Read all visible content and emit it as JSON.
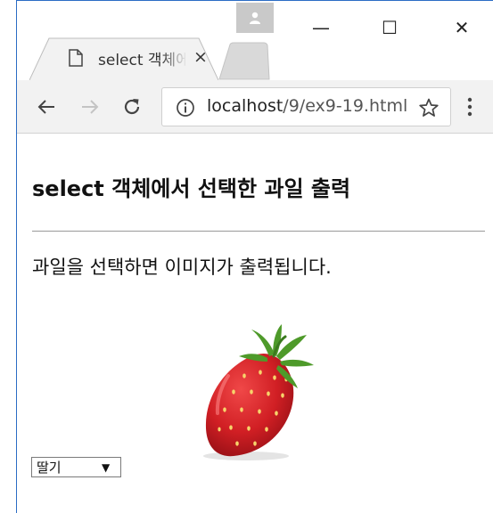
{
  "browser": {
    "tab_title": "select 객체에서 선택한 과일 출력",
    "tab_close_symbol": "×",
    "url_host": "localhost",
    "url_path": "/9/ex9-19.html",
    "window_controls": {
      "minimize": "—",
      "maximize": "☐",
      "close": "✕"
    },
    "icons": [
      "user-avatar-icon",
      "page-icon",
      "back-arrow-icon",
      "forward-arrow-icon",
      "reload-icon",
      "info-icon",
      "star-icon",
      "menu-dots-icon"
    ]
  },
  "page": {
    "heading": "select 객체에서 선택한 과일 출력",
    "instruction": "과일을 선택하면 이미지가 출력됩니다.",
    "image_subject": "strawberry",
    "select": {
      "selected": "딸기",
      "arrow": "▼"
    }
  },
  "colors": {
    "window_border": "#2b6cc4",
    "toolbar_bg": "#f2f2f2",
    "strawberry_red": "#d11f24",
    "leaf_green": "#4e9a2a"
  }
}
